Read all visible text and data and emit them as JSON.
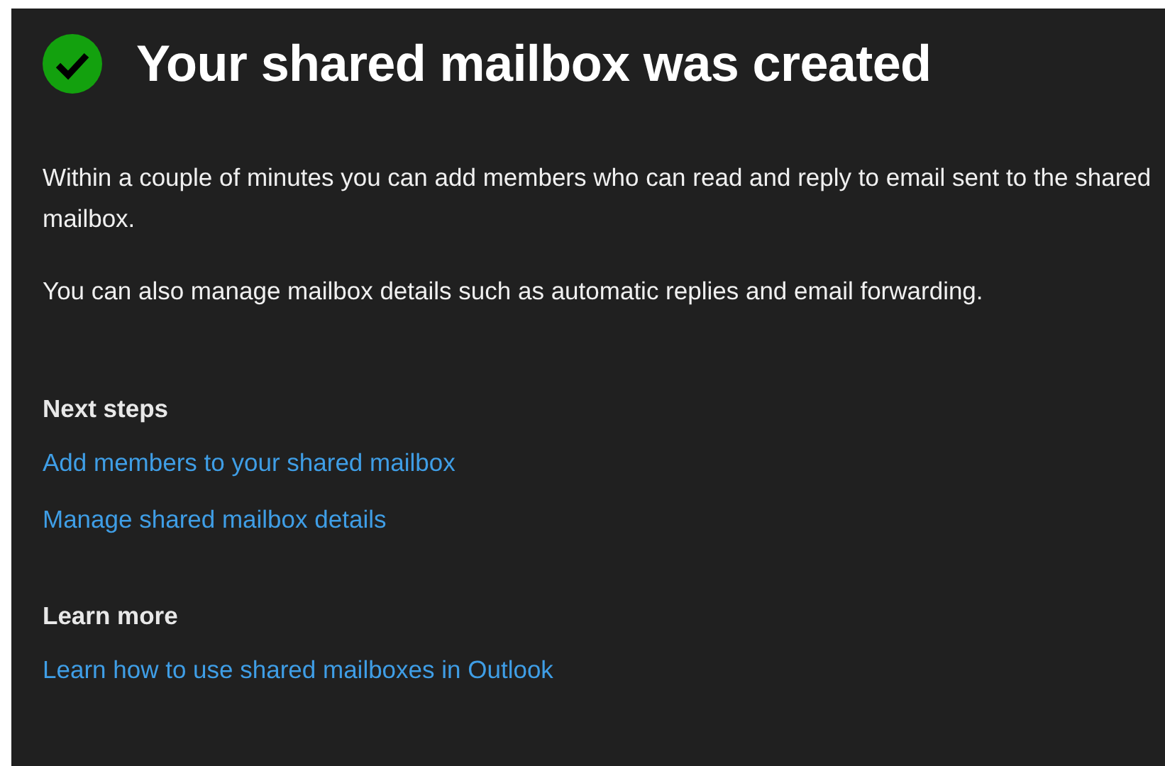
{
  "title": "Your shared mailbox was created",
  "paragraphs": [
    "Within a couple of minutes you can add members who can read and reply to email sent to the shared mailbox.",
    "You can also manage mailbox details such as automatic replies and email forwarding."
  ],
  "sections": [
    {
      "heading": "Next steps",
      "links": [
        "Add members to your shared mailbox",
        "Manage shared mailbox details"
      ]
    },
    {
      "heading": "Learn more",
      "links": [
        "Learn how to use shared mailboxes in Outlook"
      ]
    }
  ]
}
